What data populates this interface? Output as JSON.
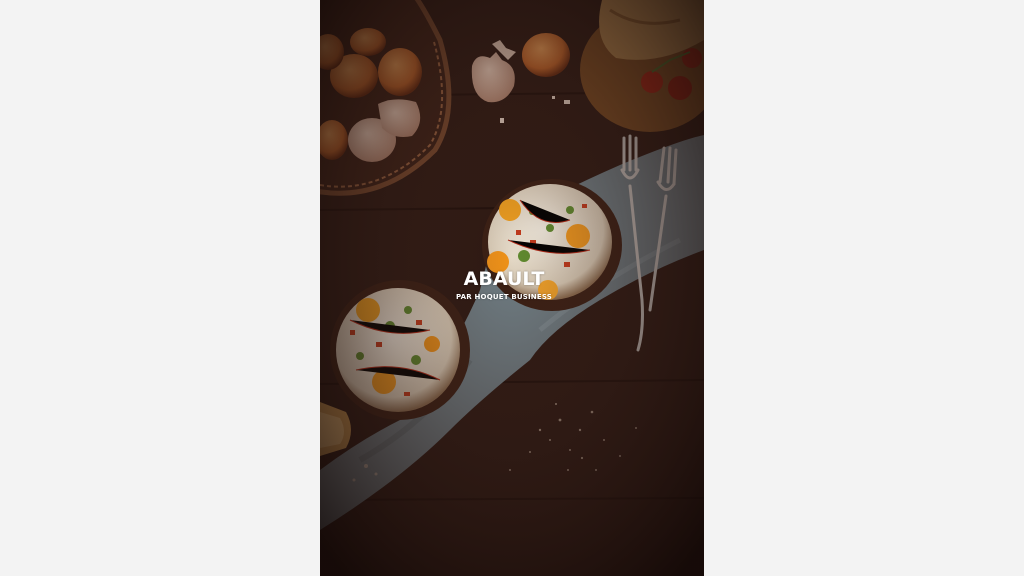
{
  "watermark": {
    "brand": "ABAULT",
    "tagline": "PAR HOQUET BUSINESS"
  },
  "colors": {
    "page_background": "#f3f3f3",
    "table_wood": "#2a1712",
    "cloth": "#6f7f86",
    "egg_yolk": "#f39a1f",
    "egg_white": "#efe9dc"
  },
  "scene": {
    "subject": "baked eggs in ramekins on dark wooden table"
  }
}
